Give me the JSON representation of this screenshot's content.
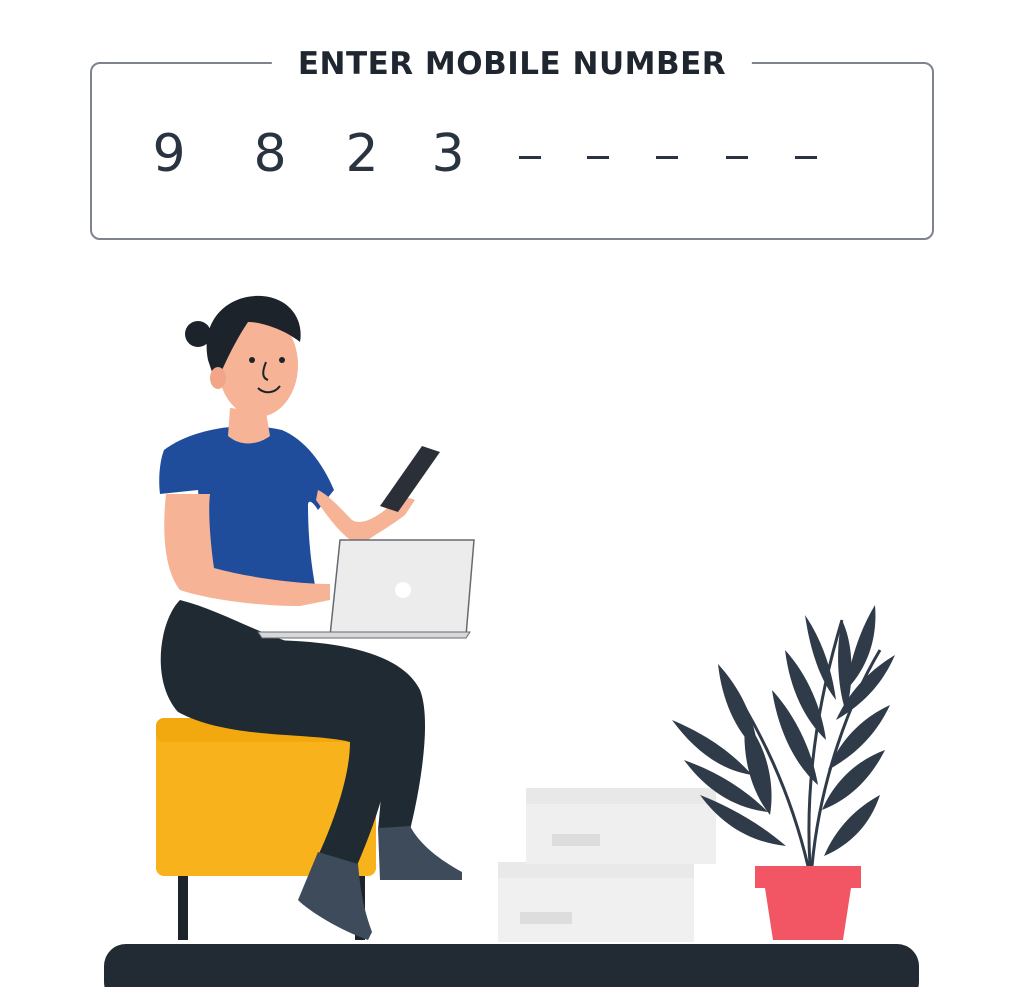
{
  "phone_entry": {
    "title": "ENTER MOBILE NUMBER",
    "entered_digits": [
      "9",
      "8",
      "2",
      "3"
    ],
    "remaining_placeholders": 5
  },
  "illustration": {
    "icon": "woman-with-phone-and-laptop-illustration",
    "colors": {
      "shirt": "#1f4d9c",
      "pants": "#1f2a33",
      "seat": "#f8b21b",
      "plant_pot": "#f25563",
      "plant_leaves": "#2f3b48",
      "floor": "#222a33",
      "skin": "#f6b396"
    }
  }
}
